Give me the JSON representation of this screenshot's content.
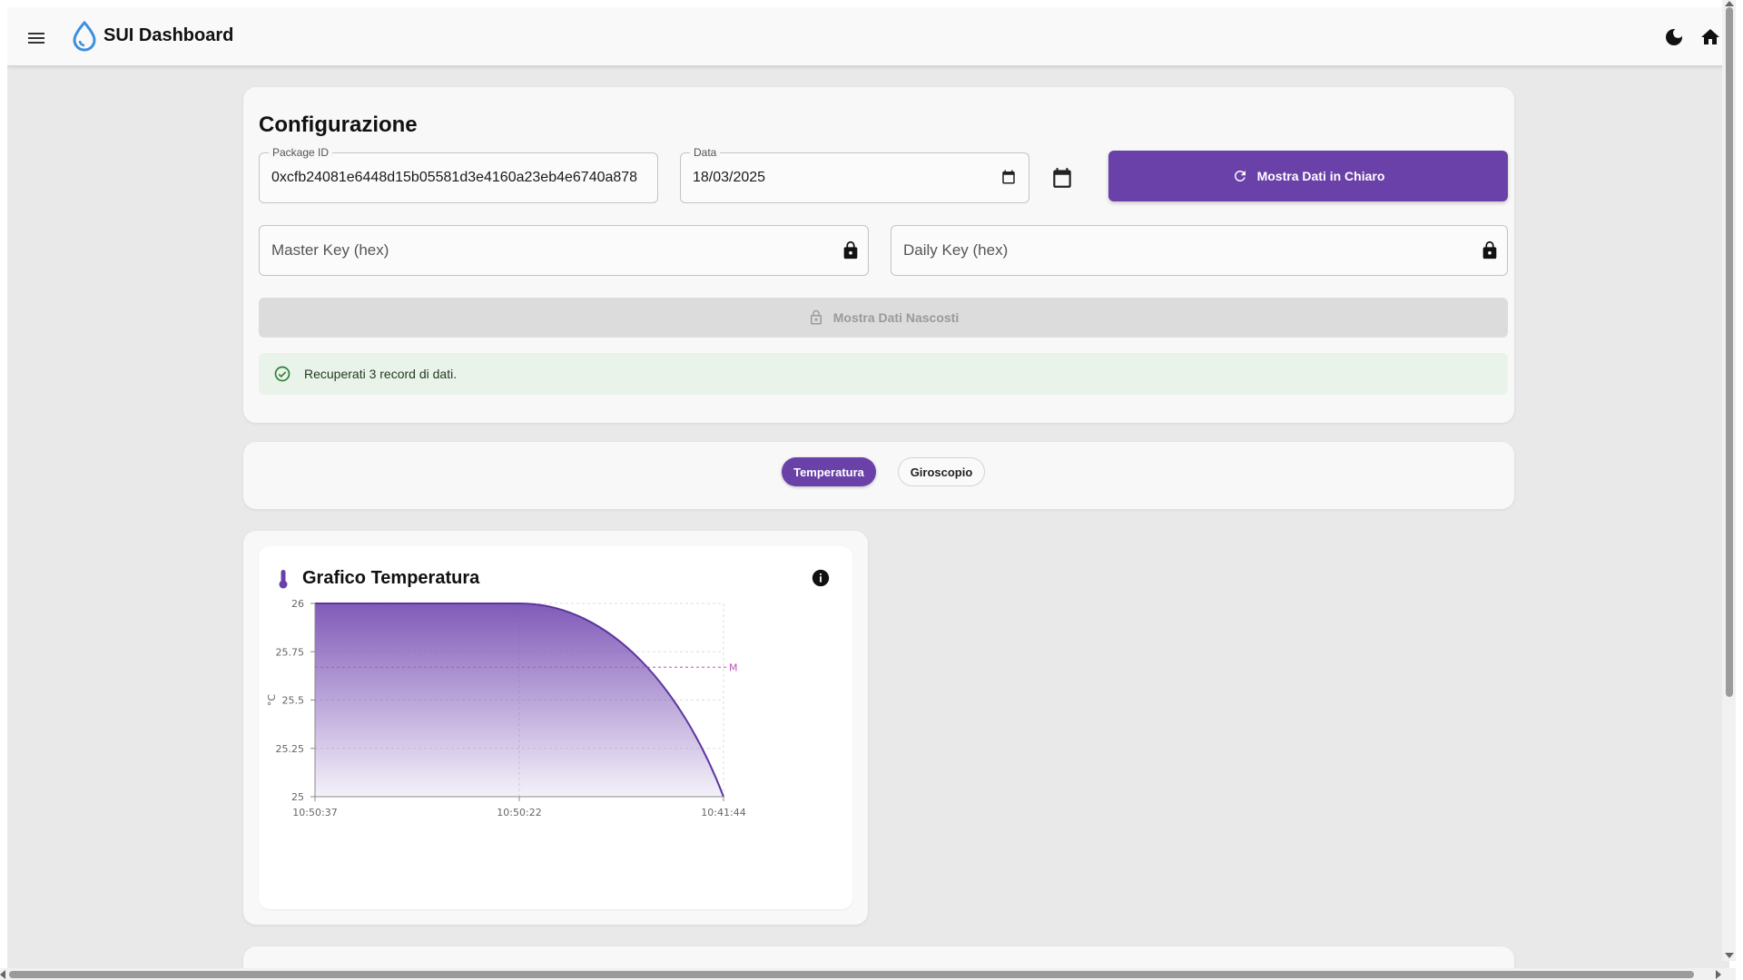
{
  "app": {
    "title": "SUI Dashboard"
  },
  "icons": {
    "menu": "menu-icon",
    "logo": "water-drop-icon",
    "theme": "moon-icon",
    "home": "home-icon",
    "refresh": "refresh-icon",
    "calendar": "calendar-icon",
    "lock": "lock-icon",
    "check": "check-circle-icon",
    "thermometer": "thermometer-icon",
    "info": "info-icon"
  },
  "colors": {
    "accent": "#6a41a8",
    "success": "#2e7d32",
    "success_bg": "#eaf3ea",
    "chart_line": "#5b37a0",
    "threshold": "#c04fc0",
    "logo": "#3d8fe0"
  },
  "config": {
    "title": "Configurazione",
    "package": {
      "label": "Package ID",
      "value": "0xcfb24081e6448d15b05581d3e4160a23eb4e6740a878"
    },
    "date": {
      "label": "Data",
      "value": "18/03/2025"
    },
    "show_clear_button": "Mostra Dati in Chiaro",
    "master_key": {
      "placeholder": "Master Key (hex)"
    },
    "daily_key": {
      "placeholder": "Daily Key (hex)"
    },
    "show_hidden_button": "Mostra Dati Nascosti",
    "alert": "Recuperati 3 record di dati."
  },
  "tabs": [
    {
      "label": "Temperatura",
      "active": true
    },
    {
      "label": "Giroscopio",
      "active": false
    }
  ],
  "chart": {
    "title": "Grafico Temperatura"
  },
  "chart_data": {
    "type": "area",
    "title": "Grafico Temperatura",
    "xlabel": "",
    "ylabel": "°C",
    "categories": [
      "10:50:37",
      "10:50:22",
      "10:41:44"
    ],
    "series": [
      {
        "values": [
          26,
          26,
          25
        ]
      }
    ],
    "ylim": [
      25,
      26
    ],
    "yticks": [
      25,
      25.25,
      25.5,
      25.75,
      26
    ],
    "yticklabels": [
      "25",
      "25.25",
      "25.5",
      "25.75",
      "26"
    ],
    "reference_line": {
      "y": 25.67,
      "label": "M"
    },
    "grid": true
  }
}
